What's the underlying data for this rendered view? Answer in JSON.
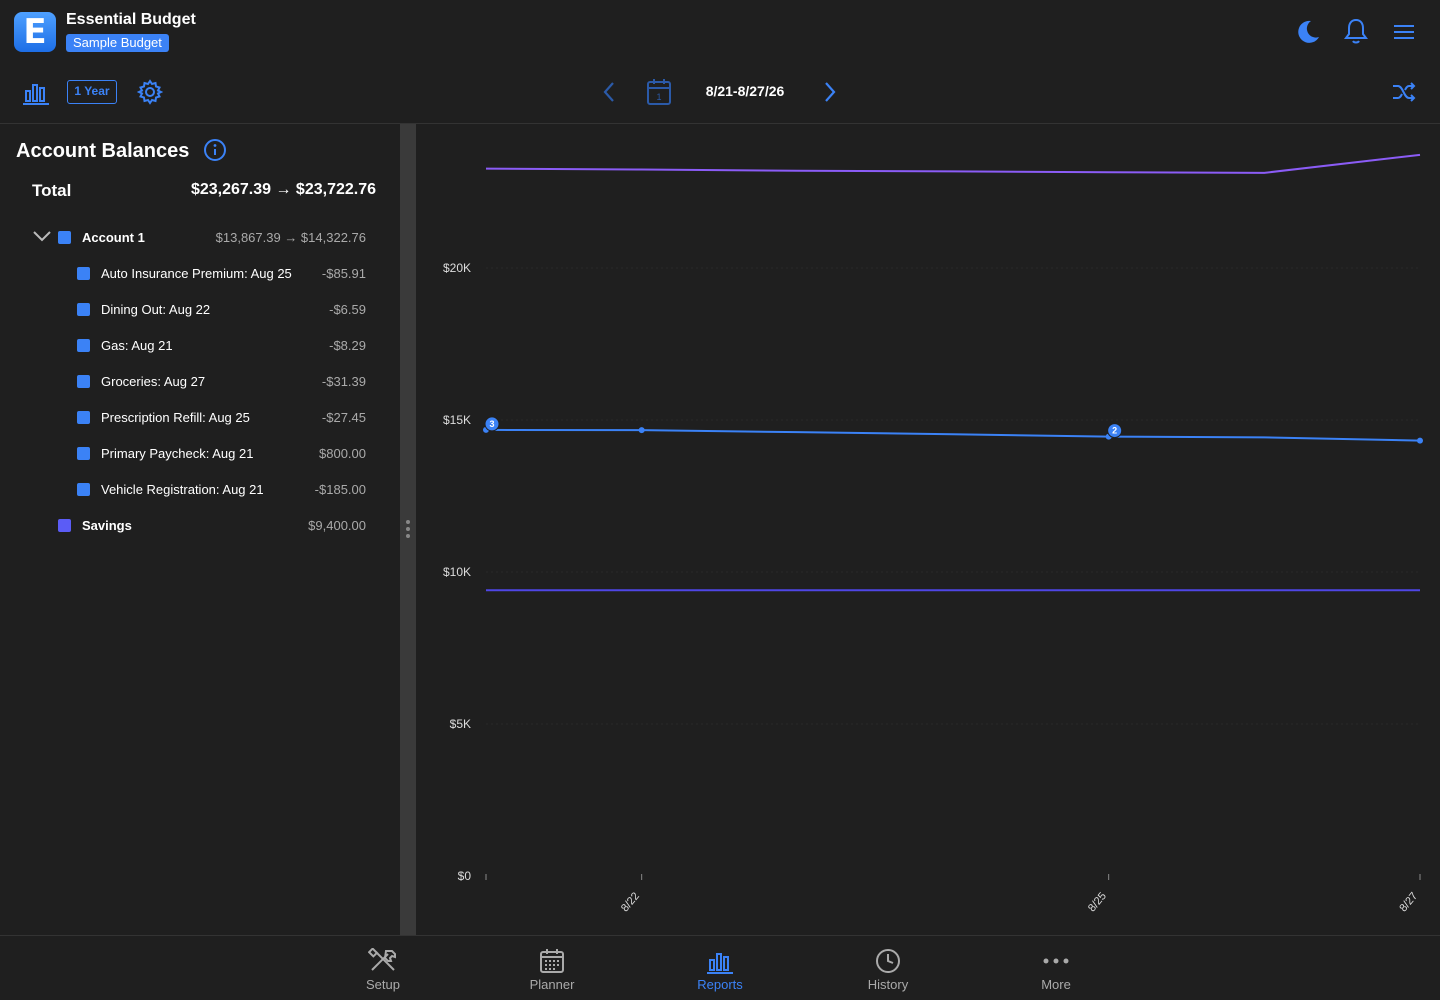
{
  "app": {
    "title": "Essential Budget",
    "budget_name": "Sample Budget",
    "logo_letter": "E"
  },
  "toolbar": {
    "period_label": "1 Year",
    "date_range": "8/21-8/27/26",
    "icons": [
      "bar-chart-icon",
      "gear-icon",
      "chevron-left-icon",
      "calendar-icon",
      "chevron-right-icon",
      "shuffle-icon",
      "moon-icon",
      "bell-icon",
      "menu-icon"
    ]
  },
  "sidebar": {
    "title": "Account Balances",
    "total_label": "Total",
    "total_value": "$23,267.39 → $23,722.76",
    "accounts": [
      {
        "name": "Account 1",
        "value": "$13,867.39 → $14,322.76",
        "expanded": true,
        "items": [
          {
            "label": "Auto Insurance Premium: Aug 25",
            "amount": "-$85.91"
          },
          {
            "label": "Dining Out: Aug 22",
            "amount": "-$6.59"
          },
          {
            "label": "Gas: Aug 21",
            "amount": "-$8.29"
          },
          {
            "label": "Groceries: Aug 27",
            "amount": "-$31.39"
          },
          {
            "label": "Prescription Refill: Aug 25",
            "amount": "-$27.45"
          },
          {
            "label": "Primary Paycheck: Aug 21",
            "amount": "$800.00"
          },
          {
            "label": "Vehicle Registration: Aug 21",
            "amount": "-$185.00"
          }
        ]
      },
      {
        "name": "Savings",
        "value": "$9,400.00"
      }
    ]
  },
  "chart_data": {
    "type": "line",
    "y_ticks": [
      "$0",
      "$5K",
      "$10K",
      "$15K",
      "$20K"
    ],
    "ylim": [
      0,
      24000
    ],
    "x_labels": [
      "8/22",
      "8/25",
      "8/27"
    ],
    "x_dates": [
      "8/21",
      "8/22",
      "8/23",
      "8/24",
      "8/25",
      "8/26",
      "8/27"
    ],
    "series": [
      {
        "color": "#8b5cf6",
        "values": [
          23267.39,
          23240,
          23200,
          23180,
          23150,
          23130,
          23722.76
        ]
      },
      {
        "color": "#3b82f6",
        "values": [
          14673.71,
          14667.12,
          14600,
          14530,
          14454.36,
          14430,
          14322.76
        ]
      },
      {
        "color": "#4f46e5",
        "values": [
          9400,
          9400,
          9400,
          9400,
          9400,
          9400,
          9400
        ]
      }
    ],
    "markers": [
      {
        "date": "8/21",
        "count": "3"
      },
      {
        "date": "8/25",
        "count": "2"
      }
    ]
  },
  "nav": {
    "items": [
      {
        "label": "Setup",
        "icon": "tools-icon"
      },
      {
        "label": "Planner",
        "icon": "calendar-grid-icon"
      },
      {
        "label": "Reports",
        "icon": "bar-chart-icon",
        "active": true
      },
      {
        "label": "History",
        "icon": "clock-icon"
      },
      {
        "label": "More",
        "icon": "more-dots-icon"
      }
    ]
  },
  "colors": {
    "accent": "#3b82f6",
    "background": "#1f1f1f"
  }
}
